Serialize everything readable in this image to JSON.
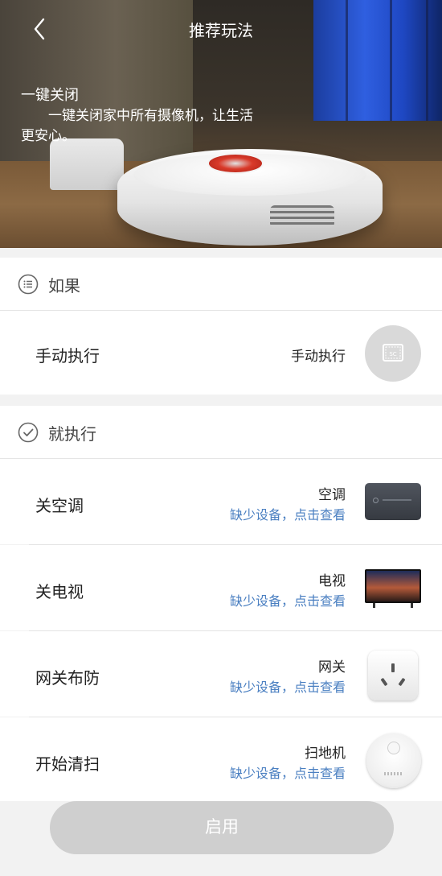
{
  "header": {
    "title": "推荐玩法"
  },
  "hero": {
    "title": "一键关闭",
    "description": "一键关闭家中所有摄像机，让生活更安心。"
  },
  "if_section": {
    "label": "如果",
    "row": {
      "name": "手动执行",
      "device": "手动执行"
    }
  },
  "then_section": {
    "label": "就执行",
    "actions": [
      {
        "name": "关空调",
        "device": "空调",
        "hint": "缺少设备，点击查看"
      },
      {
        "name": "关电视",
        "device": "电视",
        "hint": "缺少设备，点击查看"
      },
      {
        "name": "网关布防",
        "device": "网关",
        "hint": "缺少设备，点击查看"
      },
      {
        "name": "开始清扫",
        "device": "扫地机",
        "hint": "缺少设备，点击查看"
      }
    ]
  },
  "footer": {
    "button_label": "启用"
  },
  "colors": {
    "link": "#4a7fc1",
    "button_disabled": "#cfcfcf"
  }
}
